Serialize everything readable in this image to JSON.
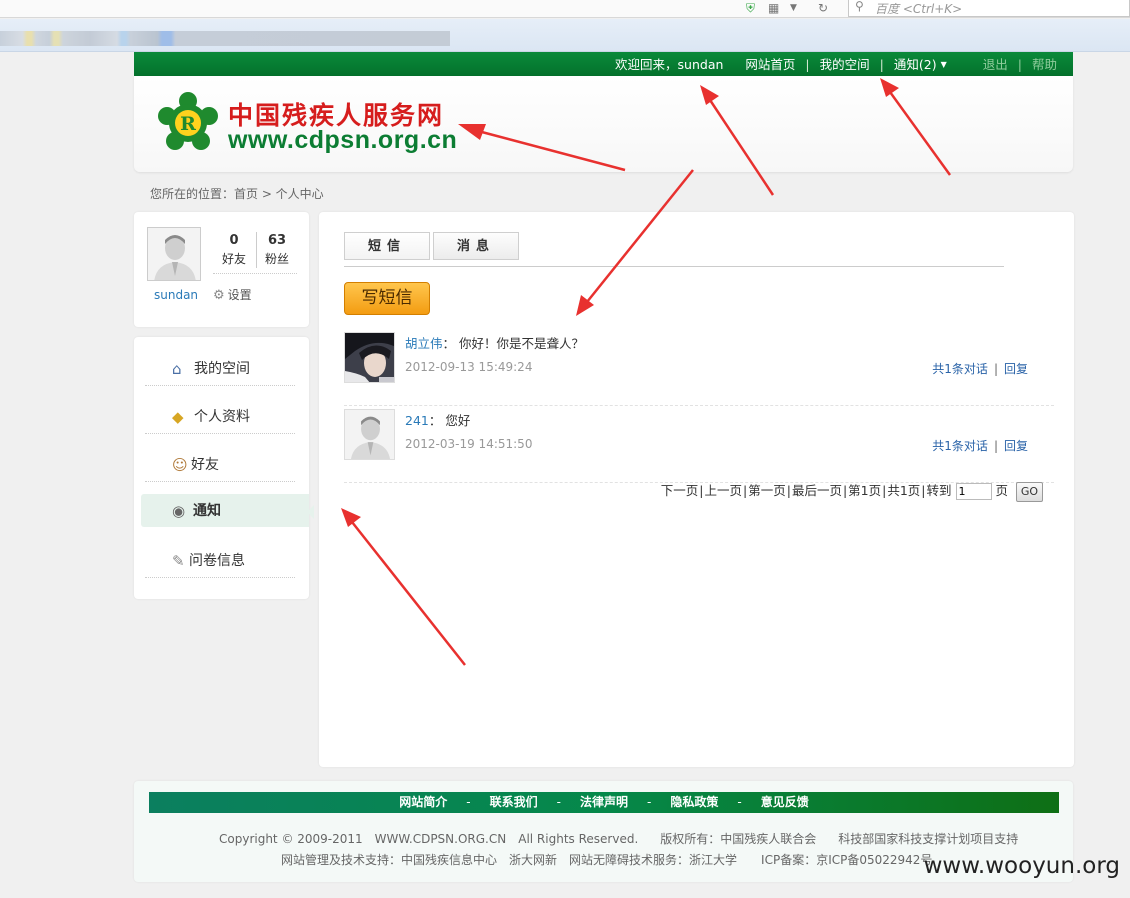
{
  "browser": {
    "search_placeholder": "百度 <Ctrl+K>"
  },
  "topnav": {
    "welcome": "欢迎回来，sundan",
    "home": "网站首页",
    "my_space": "我的空间",
    "notify": "通知(2)",
    "logout": "退出",
    "help": "帮助"
  },
  "site": {
    "name": "中国残疾人服务网",
    "url": "www.cdpsn.org.cn"
  },
  "breadcrumb": "您所在的位置：首页 > 个人中心",
  "profile": {
    "username": "sundan",
    "friends_count": "0",
    "friends_label": "好友",
    "fans_count": "63",
    "fans_label": "粉丝",
    "settings": "设置"
  },
  "menu": {
    "items": [
      {
        "label": "我的空间",
        "icon": "house-icon"
      },
      {
        "label": "个人资料",
        "icon": "folder-icon"
      },
      {
        "label": "好友",
        "icon": "people-icon"
      },
      {
        "label": "通知",
        "icon": "bell-icon"
      },
      {
        "label": "问卷信息",
        "icon": "survey-icon"
      }
    ],
    "active_index": 3
  },
  "tabs": [
    "短信",
    "消息"
  ],
  "write_button": "写短信",
  "messages": [
    {
      "sender": "胡立伟",
      "text": "你好！你是不是聋人？",
      "time": "2012-09-13 15:49:24",
      "conversation": "共1条对话",
      "reply": "回复"
    },
    {
      "sender": "241",
      "text": "您好",
      "time": "2012-03-19 14:51:50",
      "conversation": "共1条对话",
      "reply": "回复"
    }
  ],
  "pager": {
    "next": "下一页",
    "prev": "上一页",
    "first": "第一页",
    "last": "最后一页",
    "current": "第1页",
    "total": "共1页",
    "goto_label": "转到",
    "page_value": "1",
    "page_unit": "页",
    "go": "GO"
  },
  "footer": {
    "links": [
      "网站简介",
      "联系我们",
      "法律声明",
      "隐私政策",
      "意见反馈"
    ],
    "copyright": "Copyright © 2009-2011",
    "domain": "WWW.CDPSN.ORG.CN",
    "rights": "All Rights Reserved.",
    "owner": "版权所有：中国残疾人联合会",
    "support": "科技部国家科技支撑计划项目支持",
    "tech": "网站管理及技术支持：中国残疾信息中心",
    "partner": "浙大网新",
    "accessible": "网站无障碍技术服务：浙江大学",
    "icp": "ICP备案：京ICP备05022942号"
  },
  "watermark": "www.wooyun.org",
  "colors": {
    "brand_green": "#04712c",
    "brand_red": "#d61d1d",
    "link_blue": "#2a7ab8",
    "annotation_red": "#e8312f",
    "button_orange": "#f39c12"
  }
}
